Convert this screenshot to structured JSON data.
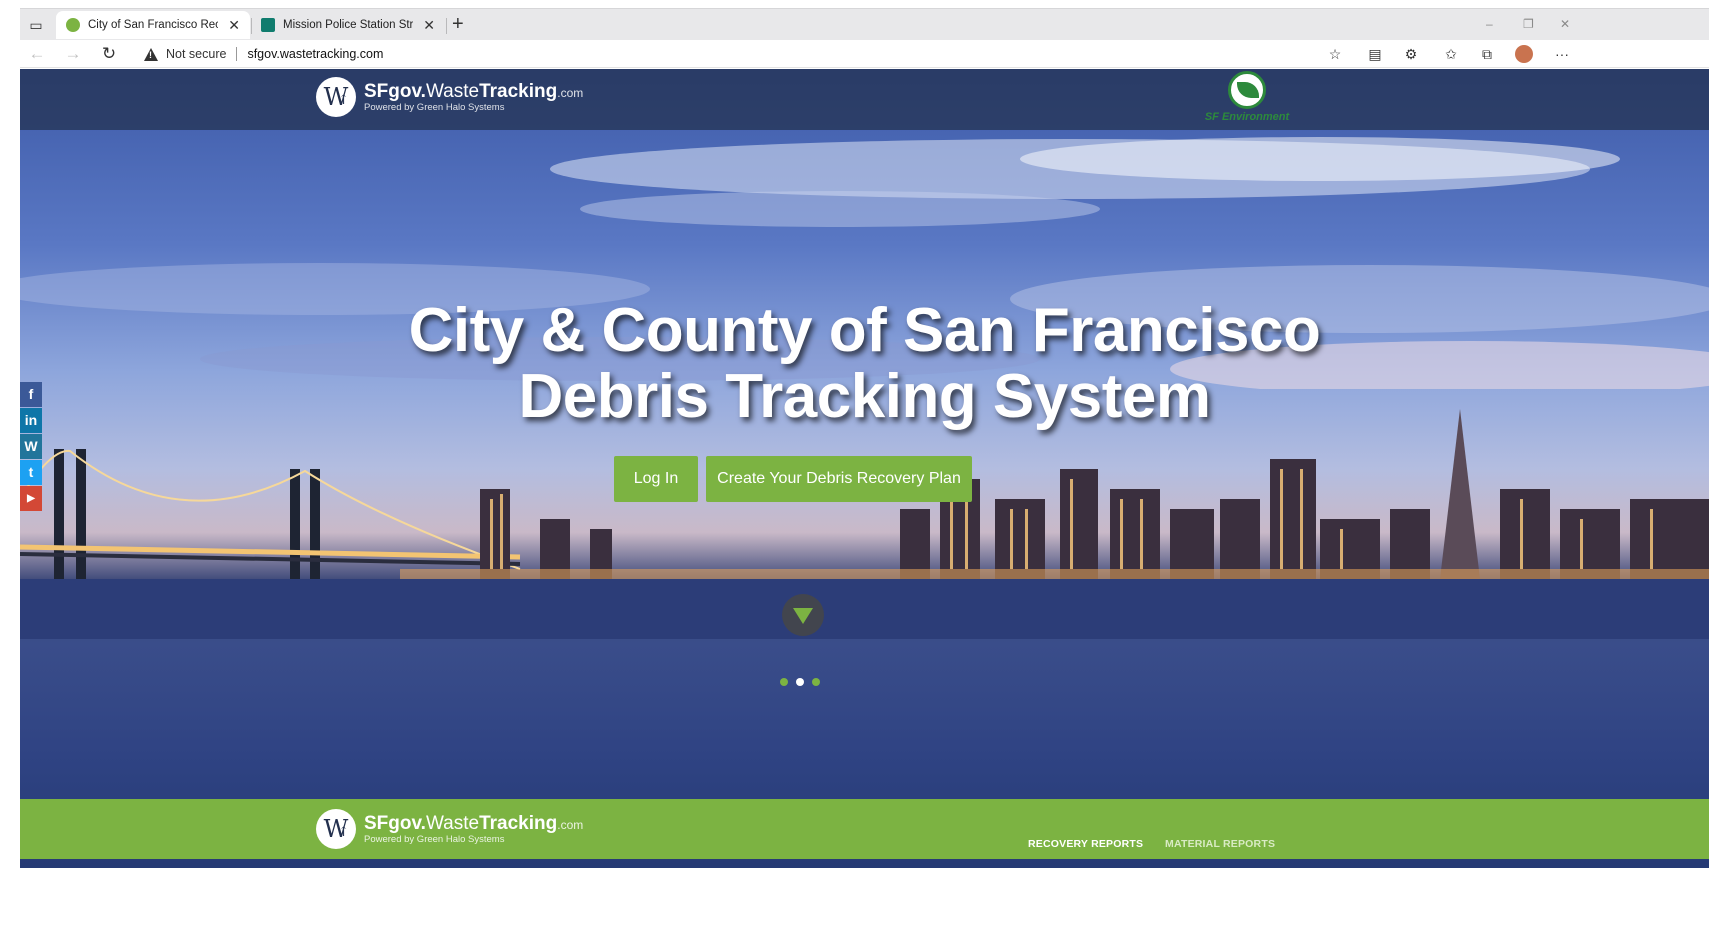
{
  "browser": {
    "tabs": [
      {
        "title": "City of San Francisco Recycling C",
        "active": true
      },
      {
        "title": "Mission Police Station Structural",
        "active": false
      }
    ],
    "new_tab": "+",
    "security_label": "Not secure",
    "url": "sfgov.wastetracking.com",
    "window_controls": {
      "minimize": "–",
      "restore": "❐",
      "close": "✕"
    },
    "toolbar_icons": [
      "add-favorite-icon",
      "reading-view-icon",
      "extensions-icon",
      "favorites-icon",
      "collections-icon",
      "profile-icon",
      "more-icon"
    ]
  },
  "header": {
    "brand_bold": "SFgov.",
    "brand_light": "Waste",
    "brand_strong": "Tracking",
    "brand_tld": ".com",
    "powered_by": "Powered by Green Halo Systems",
    "partner_logo_text": "SF Environment"
  },
  "hero": {
    "headline_line1": "City & County of San Francisco",
    "headline_line2": "Debris Tracking System",
    "login_label": "Log In",
    "plan_label": "Create Your Debris Recovery Plan",
    "slides": 3,
    "active_slide": 2
  },
  "social": [
    {
      "name": "facebook",
      "glyph": "f",
      "color": "#3b5998"
    },
    {
      "name": "linkedin",
      "glyph": "in",
      "color": "#0e76a8"
    },
    {
      "name": "wordpress",
      "glyph": "W",
      "color": "#21759b"
    },
    {
      "name": "twitter",
      "glyph": "t",
      "color": "#1da1f2"
    },
    {
      "name": "youtube",
      "glyph": "▶",
      "color": "#d34836"
    }
  ],
  "footer": {
    "nav": [
      "RECOVERY REPORTS",
      "MATERIAL REPORTS"
    ]
  },
  "colors": {
    "accent_green": "#7cb342",
    "header_band": "#23304e",
    "sfenv_green": "#2d8a3c"
  }
}
